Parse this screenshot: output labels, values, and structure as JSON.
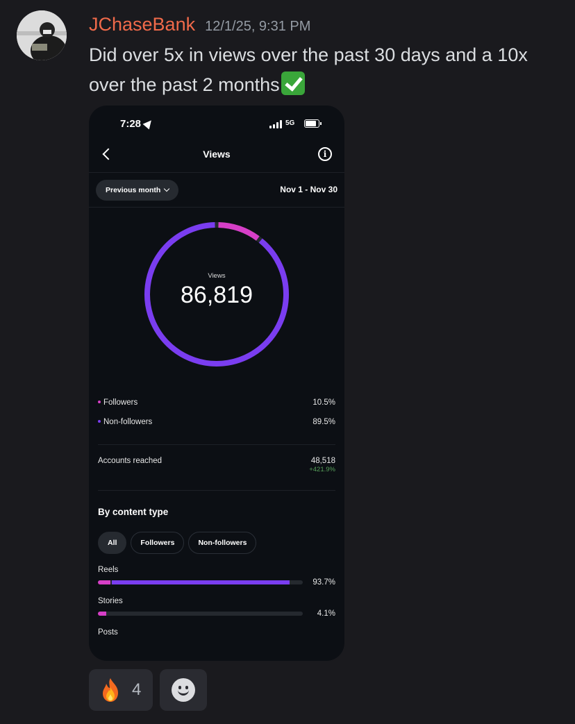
{
  "message": {
    "username": "JChaseBank",
    "timestamp": "12/1/25, 9:31 PM",
    "text": "Did over 5x in views over the past 30 days and a 10x over the past 2 months",
    "emoji_icon": "check-mark-button-emoji",
    "colors": {
      "username": "#f06a4a",
      "background": "#1a1a1e"
    }
  },
  "phone": {
    "status": {
      "time": "7:28",
      "network": "5G"
    },
    "nav": {
      "title": "Views"
    },
    "period_button": "Previous month",
    "date_range": "Nov 1 - Nov 30",
    "donut": {
      "label": "Views",
      "value": "86,819",
      "followers_fraction": 0.105,
      "colors": {
        "followers": "#d63fc7",
        "non_followers": "#7a3df0"
      }
    },
    "legend": [
      {
        "label": "Followers",
        "value": "10.5%",
        "color": "#d63fc7"
      },
      {
        "label": "Non-followers",
        "value": "89.5%",
        "color": "#7a3df0"
      }
    ],
    "accounts_reached": {
      "label": "Accounts reached",
      "value": "48,518",
      "change": "+421.9%"
    },
    "content_type": {
      "title": "By content type",
      "chips": [
        "All",
        "Followers",
        "Non-followers"
      ],
      "rows": [
        {
          "label": "Reels",
          "value": "93.7%",
          "total_fraction": 0.937,
          "followers_fraction": 0.06
        },
        {
          "label": "Stories",
          "value": "4.1%",
          "total_fraction": 0.041,
          "followers_fraction": 0.041
        },
        {
          "label": "Posts",
          "value": ""
        }
      ]
    }
  },
  "reactions": [
    {
      "icon": "fire-emoji",
      "count": "4"
    },
    {
      "icon": "add-reaction-smiley-icon"
    }
  ]
}
